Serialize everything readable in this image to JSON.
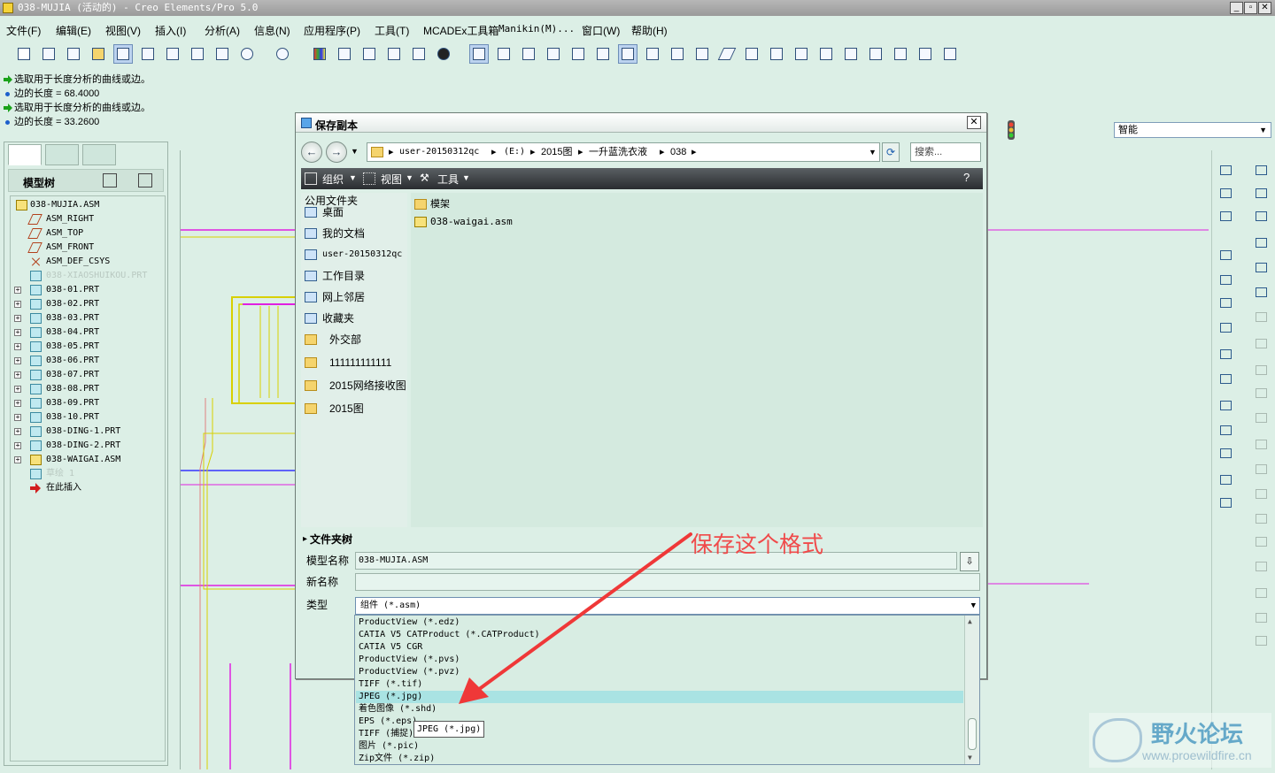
{
  "window": {
    "title": "038-MUJIA (活动的) - Creo Elements/Pro 5.0"
  },
  "menu": [
    "文件(F)",
    "编辑(E)",
    "视图(V)",
    "插入(I)",
    "分析(A)",
    "信息(N)",
    "应用程序(P)",
    "工具(T)",
    "MCADEx工具箱",
    "Manikin(M)...",
    "窗口(W)",
    "帮助(H)"
  ],
  "messages": [
    {
      "kind": "prompt",
      "text": "选取用于长度分析的曲线或边。"
    },
    {
      "kind": "info",
      "text": "边的长度 = 68.4000"
    },
    {
      "kind": "prompt",
      "text": "选取用于长度分析的曲线或边。"
    },
    {
      "kind": "info",
      "text": "边的长度 = 33.2600"
    }
  ],
  "filter": {
    "value": "智能"
  },
  "model_tree": {
    "header": "模型树",
    "nodes": [
      {
        "label": "038-MUJIA.ASM",
        "type": "asm",
        "level": 0
      },
      {
        "label": "ASM_RIGHT",
        "type": "plane",
        "level": 1
      },
      {
        "label": "ASM_TOP",
        "type": "plane",
        "level": 1
      },
      {
        "label": "ASM_FRONT",
        "type": "plane",
        "level": 1
      },
      {
        "label": "ASM_DEF_CSYS",
        "type": "csys",
        "level": 1
      },
      {
        "label": "038-XIAOSHUIKOU.PRT",
        "type": "part",
        "level": 1,
        "dim": true
      },
      {
        "label": "038-01.PRT",
        "type": "part",
        "level": 1
      },
      {
        "label": "038-02.PRT",
        "type": "part",
        "level": 1
      },
      {
        "label": "038-03.PRT",
        "type": "part",
        "level": 1
      },
      {
        "label": "038-04.PRT",
        "type": "part",
        "level": 1
      },
      {
        "label": "038-05.PRT",
        "type": "part",
        "level": 1
      },
      {
        "label": "038-06.PRT",
        "type": "part",
        "level": 1
      },
      {
        "label": "038-07.PRT",
        "type": "part",
        "level": 1
      },
      {
        "label": "038-08.PRT",
        "type": "part",
        "level": 1
      },
      {
        "label": "038-09.PRT",
        "type": "part",
        "level": 1
      },
      {
        "label": "038-10.PRT",
        "type": "part",
        "level": 1
      },
      {
        "label": "038-DING-1.PRT",
        "type": "part",
        "level": 1
      },
      {
        "label": "038-DING-2.PRT",
        "type": "part",
        "level": 1
      },
      {
        "label": "038-WAIGAI.ASM",
        "type": "asm",
        "level": 1
      },
      {
        "label": "草绘 1",
        "type": "part",
        "level": 1,
        "dim": true
      },
      {
        "label": "在此插入",
        "type": "insert",
        "level": 1
      }
    ]
  },
  "dialog": {
    "title": "保存副本",
    "address": [
      "user-20150312qc",
      "(E:)",
      "2015图",
      "一升蓝洗衣液",
      "038"
    ],
    "search_placeholder": "搜索...",
    "cmd": {
      "organize": "组织",
      "views": "视图",
      "tools": "工具"
    },
    "places_header": "公用文件夹",
    "places": [
      "桌面",
      "我的文档",
      "user-20150312qc",
      "工作目录",
      "网上邻居",
      "收藏夹",
      "外交部",
      "111111111111",
      "2015网络接收图",
      "2015图"
    ],
    "files": [
      {
        "name": "模架",
        "type": "folder"
      },
      {
        "name": "038-waigai.asm",
        "type": "asm"
      }
    ],
    "folder_tree": "文件夹树",
    "model_name_label": "模型名称",
    "model_name": "038-MUJIA.ASM",
    "new_name_label": "新名称",
    "new_name": "",
    "type_label": "类型",
    "type_value": "组件 (*.asm)",
    "type_options": [
      "ProductView (*.edz)",
      "CATIA V5 CATProduct (*.CATProduct)",
      "CATIA V5 CGR",
      "ProductView (*.pvs)",
      "ProductView (*.pvz)",
      "TIFF (*.tif)",
      "JPEG (*.jpg)",
      "着色图像 (*.shd)",
      "EPS (*.eps)",
      "TIFF (捕捉) (*.tif)",
      "图片 (*.pic)",
      "Zip文件 (*.zip)"
    ],
    "highlighted_option": 6,
    "tooltip": "JPEG (*.jpg)"
  },
  "annotation": {
    "text": "保存这个格式",
    "color": "#f04a4a"
  },
  "watermark": {
    "text": "野火论坛",
    "url": "www.proewildfire.cn"
  },
  "colors": {
    "background": "#dcefe6",
    "wire_yellow": "#d8d000",
    "wire_magenta": "#e020e0",
    "wire_blue": "#3434ff"
  }
}
